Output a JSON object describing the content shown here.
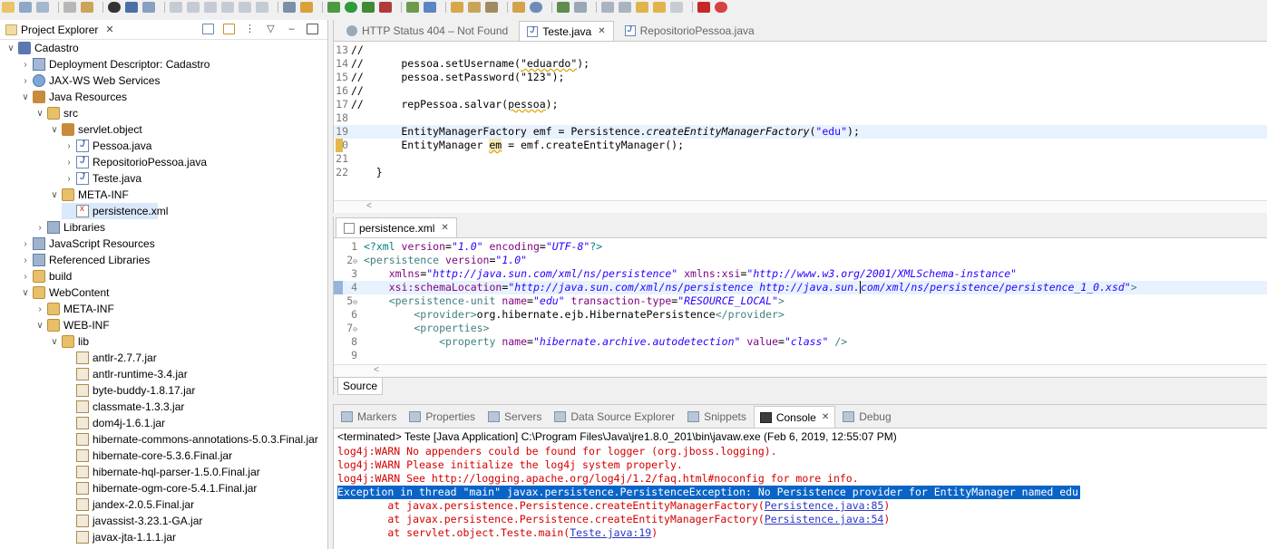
{
  "explorer": {
    "title": "Project Explorer",
    "tree": [
      {
        "label": "Cadastro",
        "icon": "project-icon",
        "depth": 0,
        "twist": "v"
      },
      {
        "label": "Deployment Descriptor: Cadastro",
        "icon": "deployment-descriptor-icon",
        "depth": 1,
        "twist": ">"
      },
      {
        "label": "JAX-WS Web Services",
        "icon": "web-services-icon",
        "depth": 1,
        "twist": ">"
      },
      {
        "label": "Java Resources",
        "icon": "java-resources-icon",
        "depth": 1,
        "twist": "v"
      },
      {
        "label": "src",
        "icon": "source-folder-icon",
        "depth": 2,
        "twist": "v"
      },
      {
        "label": "servlet.object",
        "icon": "package-icon",
        "depth": 3,
        "twist": "v"
      },
      {
        "label": "Pessoa.java",
        "icon": "java-file-icon",
        "depth": 4,
        "twist": ">"
      },
      {
        "label": "RepositorioPessoa.java",
        "icon": "java-file-icon",
        "depth": 4,
        "twist": ">"
      },
      {
        "label": "Teste.java",
        "icon": "java-file-icon",
        "depth": 4,
        "twist": ">"
      },
      {
        "label": "META-INF",
        "icon": "folder-icon",
        "depth": 3,
        "twist": "v"
      },
      {
        "label": "persistence.xml",
        "icon": "xml-file-icon",
        "depth": 4,
        "twist": "",
        "selected": true
      },
      {
        "label": "Libraries",
        "icon": "library-icon",
        "depth": 2,
        "twist": ">"
      },
      {
        "label": "JavaScript Resources",
        "icon": "javascript-resources-icon",
        "depth": 1,
        "twist": ">"
      },
      {
        "label": "Referenced Libraries",
        "icon": "referenced-libraries-icon",
        "depth": 1,
        "twist": ">"
      },
      {
        "label": "build",
        "icon": "folder-icon",
        "depth": 1,
        "twist": ">"
      },
      {
        "label": "WebContent",
        "icon": "folder-icon",
        "depth": 1,
        "twist": "v"
      },
      {
        "label": "META-INF",
        "icon": "folder-icon",
        "depth": 2,
        "twist": ">"
      },
      {
        "label": "WEB-INF",
        "icon": "folder-icon",
        "depth": 2,
        "twist": "v"
      },
      {
        "label": "lib",
        "icon": "folder-icon",
        "depth": 3,
        "twist": "v"
      },
      {
        "label": "antlr-2.7.7.jar",
        "icon": "jar-icon",
        "depth": 4,
        "twist": ""
      },
      {
        "label": "antlr-runtime-3.4.jar",
        "icon": "jar-icon",
        "depth": 4,
        "twist": ""
      },
      {
        "label": "byte-buddy-1.8.17.jar",
        "icon": "jar-icon",
        "depth": 4,
        "twist": ""
      },
      {
        "label": "classmate-1.3.3.jar",
        "icon": "jar-icon",
        "depth": 4,
        "twist": ""
      },
      {
        "label": "dom4j-1.6.1.jar",
        "icon": "jar-icon",
        "depth": 4,
        "twist": ""
      },
      {
        "label": "hibernate-commons-annotations-5.0.3.Final.jar",
        "icon": "jar-icon",
        "depth": 4,
        "twist": ""
      },
      {
        "label": "hibernate-core-5.3.6.Final.jar",
        "icon": "jar-icon",
        "depth": 4,
        "twist": ""
      },
      {
        "label": "hibernate-hql-parser-1.5.0.Final.jar",
        "icon": "jar-icon",
        "depth": 4,
        "twist": ""
      },
      {
        "label": "hibernate-ogm-core-5.4.1.Final.jar",
        "icon": "jar-icon",
        "depth": 4,
        "twist": ""
      },
      {
        "label": "jandex-2.0.5.Final.jar",
        "icon": "jar-icon",
        "depth": 4,
        "twist": ""
      },
      {
        "label": "javassist-3.23.1-GA.jar",
        "icon": "jar-icon",
        "depth": 4,
        "twist": ""
      },
      {
        "label": "javax-jta-1.1.1.jar",
        "icon": "jar-icon",
        "depth": 4,
        "twist": ""
      }
    ]
  },
  "editor": {
    "tabs": [
      {
        "label": "HTTP Status 404 – Not Found",
        "icon": "globe-icon",
        "active": false,
        "closable": false
      },
      {
        "label": "Teste.java",
        "icon": "java-file-icon",
        "active": true,
        "closable": true
      },
      {
        "label": "RepositorioPessoa.java",
        "icon": "java-file-icon",
        "active": false,
        "closable": false
      }
    ],
    "line_numbers": [
      "13",
      "14",
      "15",
      "16",
      "17",
      "18",
      "19",
      "20",
      "21",
      "22"
    ],
    "lines": {
      "l13": "//",
      "l14a": "//      pessoa.setUsername(",
      "l14b": "\"eduardo\"",
      "l14c": ");",
      "l15a": "//      pessoa.setPassword(",
      "l15b": "\"123\"",
      "l15c": ");",
      "l16": "//",
      "l17a": "//      repPessoa.salvar(",
      "l17b": "pessoa",
      "l17c": ");",
      "l18": "",
      "l19a": "        EntityManagerFactory ",
      "l19b": "emf",
      "l19c": " = Persistence.",
      "l19d": "createEntityManagerFactory",
      "l19e": "(",
      "l19f": "\"edu\"",
      "l19g": ");",
      "l20a": "        EntityManager ",
      "l20b": "em",
      "l20c": " = ",
      "l20d": "emf",
      "l20e": ".createEntityManager();",
      "l21": "",
      "l22": "    }"
    },
    "scroll_arrow": "<"
  },
  "xml_editor": {
    "tab": {
      "label": "persistence.xml",
      "icon": "xml-file-icon",
      "closable": true
    },
    "line_numbers": [
      "1",
      "2",
      "3",
      "4",
      "5",
      "6",
      "7",
      "8",
      "9"
    ],
    "lines": {
      "x1a": "<?xml ",
      "x1b": "version",
      "x1c": "=",
      "x1d": "\"1.0\"",
      "x1e": " encoding",
      "x1f": "=",
      "x1g": "\"UTF-8\"",
      "x1h": "?>",
      "x2a": "<persistence ",
      "x2b": "version",
      "x2c": "=",
      "x2d": "\"1.0\"",
      "x3a": "    xmlns",
      "x3b": "=",
      "x3c": "\"http://java.sun.com/xml/ns/persistence\"",
      "x3d": " xmlns:xsi",
      "x3e": "=",
      "x3f": "\"http://www.w3.org/2001/XMLSchema-instance\"",
      "x4a": "    xsi:schemaLocation",
      "x4b": "=",
      "x4c": "\"http://java.sun.com/xml/ns/persistence http://java.sun.",
      "x4d": "com/xml/ns/persistence/persistence_1_0.xsd\"",
      "x4e": ">",
      "x5a": "    <persistence-unit ",
      "x5b": "name",
      "x5c": "=",
      "x5d": "\"edu\"",
      "x5e": " transaction-type",
      "x5f": "=",
      "x5g": "\"RESOURCE_LOCAL\"",
      "x5h": ">",
      "x6a": "        <provider>",
      "x6b": "org.hibernate.ejb.HibernatePersistence",
      "x6c": "</provider>",
      "x7a": "        <properties>",
      "x8a": "            <property ",
      "x8b": "name",
      "x8c": "=",
      "x8d": "\"hibernate.archive.autodetection\"",
      "x8e": " value",
      "x8f": "=",
      "x8g": "\"class\"",
      "x8h": " />",
      "x9": ""
    },
    "scroll_arrow": "<",
    "source_tab": "Source"
  },
  "panel": {
    "tabs": [
      {
        "label": "Markers",
        "icon": "markers-icon",
        "active": false
      },
      {
        "label": "Properties",
        "icon": "properties-icon",
        "active": false
      },
      {
        "label": "Servers",
        "icon": "servers-icon",
        "active": false
      },
      {
        "label": "Data Source Explorer",
        "icon": "data-source-icon",
        "active": false
      },
      {
        "label": "Snippets",
        "icon": "snippets-icon",
        "active": false
      },
      {
        "label": "Console",
        "icon": "console-icon",
        "active": true
      },
      {
        "label": "Debug",
        "icon": "debug-icon",
        "active": false
      }
    ],
    "console_status": "<terminated> Teste [Java Application] C:\\Program Files\\Java\\jre1.8.0_201\\bin\\javaw.exe (Feb 6, 2019, 12:55:07 PM)",
    "console": {
      "c1": "log4j:WARN No appenders could be found for logger (org.jboss.logging).",
      "c2": "log4j:WARN Please initialize the log4j system properly.",
      "c3": "log4j:WARN See http://logging.apache.org/log4j/1.2/faq.html#noconfig for more info.",
      "c4": "Exception in thread \"main\" javax.persistence.PersistenceException: No Persistence provider for EntityManager named edu",
      "c5a": "        at javax.persistence.Persistence.createEntityManagerFactory(",
      "c5b": "Persistence.java:85",
      "c5c": ")",
      "c6a": "        at javax.persistence.Persistence.createEntityManagerFactory(",
      "c6b": "Persistence.java:54",
      "c6c": ")",
      "c7a": "        at servlet.object.Teste.main(",
      "c7b": "Teste.java:19",
      "c7c": ")"
    }
  },
  "colors": {
    "console_error": "#d50000",
    "selection": "#0a64c8",
    "comment": "#3f7f5f",
    "string": "#2a00ff",
    "current_line": "#e8f2fe"
  }
}
